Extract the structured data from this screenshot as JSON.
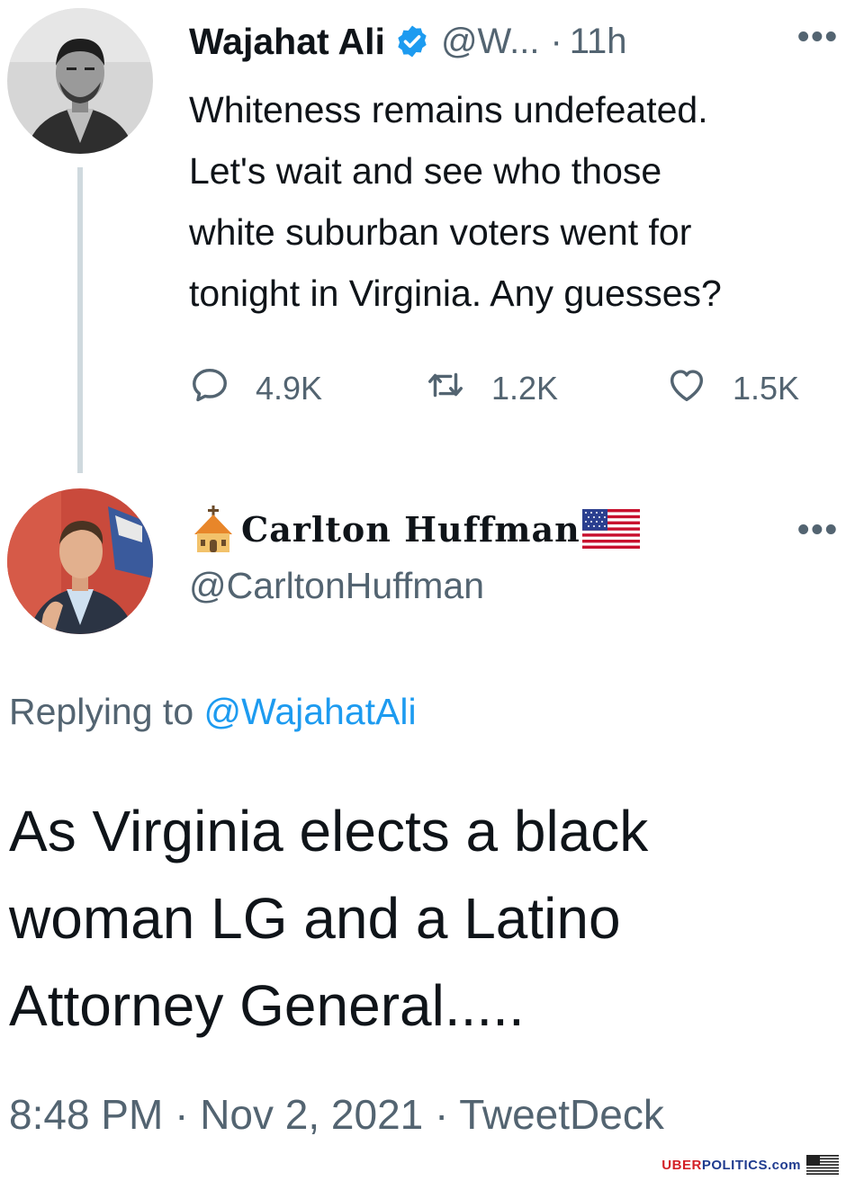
{
  "tweet1": {
    "author_name": "Wajahat Ali",
    "handle_truncated": "@W...",
    "separator": "·",
    "time": "11h",
    "more": "•••",
    "text_lines": [
      "Whiteness remains undefeated.",
      "Let's wait and see who those",
      "white suburban voters went for",
      "tonight in Virginia. Any guesses?"
    ],
    "replies": "4.9K",
    "retweets": "1.2K",
    "likes": "1.5K"
  },
  "tweet2": {
    "author_name": "Carlton Huffman",
    "handle": "@CarltonHuffman",
    "more": "•••",
    "replying_prefix": "Replying to",
    "replying_to": "@WajahatAli",
    "text_lines": [
      "As Virginia elects a black",
      "woman LG and a Latino",
      "Attorney General....."
    ],
    "timestamp": "8:48 PM · Nov 2, 2021 · TweetDeck"
  },
  "watermark": {
    "part1": "UBER",
    "part2": "POLITICS",
    "part3": ".com"
  },
  "colors": {
    "text": "#0f1419",
    "secondary": "#536471",
    "accent": "#1d9bf0",
    "thread_line": "#cfd9de"
  },
  "icons": {
    "reply": "speech-bubble-icon",
    "retweet": "retweet-arrows-icon",
    "like": "heart-outline-icon",
    "verified": "verified-badge-icon",
    "church": "church-emoji-icon",
    "flag": "us-flag-emoji-icon"
  }
}
